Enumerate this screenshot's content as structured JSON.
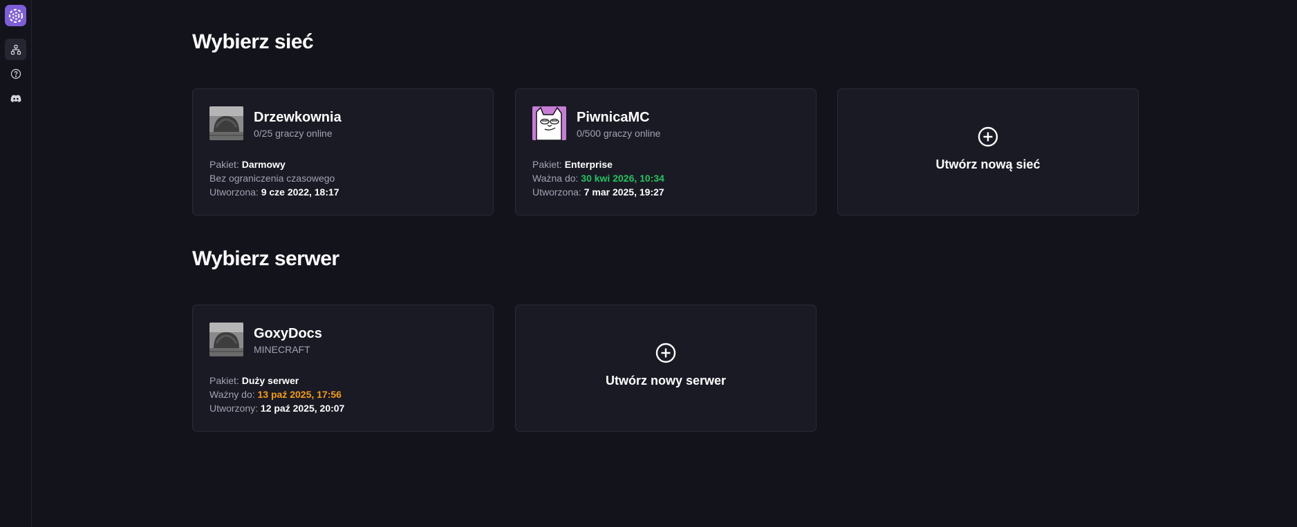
{
  "sidebar": {
    "logo_icon": "app-logo-icon",
    "items": [
      {
        "icon": "network-icon",
        "active": true
      },
      {
        "icon": "help-icon",
        "active": false
      },
      {
        "icon": "discord-icon",
        "active": false
      }
    ]
  },
  "networks_section": {
    "title": "Wybierz sieć",
    "cards": [
      {
        "name": "Drzewkownia",
        "subtitle": "0/25 graczy online",
        "package_label": "Pakiet:",
        "package_value": "Darmowy",
        "validity_text": "Bez ograniczenia czasowego",
        "created_label": "Utworzona:",
        "created_value": "9 cze 2022, 18:17"
      },
      {
        "name": "PiwnicaMC",
        "subtitle": "0/500 graczy online",
        "package_label": "Pakiet:",
        "package_value": "Enterprise",
        "valid_label": "Ważna do:",
        "valid_value": "30 kwi 2026, 10:34",
        "created_label": "Utworzona:",
        "created_value": "7 mar 2025, 19:27"
      }
    ],
    "create_label": "Utwórz nową sieć"
  },
  "servers_section": {
    "title": "Wybierz serwer",
    "cards": [
      {
        "name": "GoxyDocs",
        "subtitle": "MINECRAFT",
        "package_label": "Pakiet:",
        "package_value": "Duży serwer",
        "valid_label": "Ważny do:",
        "valid_value": "13 paź 2025, 17:56",
        "created_label": "Utworzony:",
        "created_value": "12 paź 2025, 20:07"
      }
    ],
    "create_label": "Utwórz nowy serwer"
  },
  "colors": {
    "background": "#13131c",
    "card": "#1a1a25",
    "accent": "#7d5ed8",
    "valid_green": "#22c55e",
    "valid_amber": "#f59e0b"
  }
}
